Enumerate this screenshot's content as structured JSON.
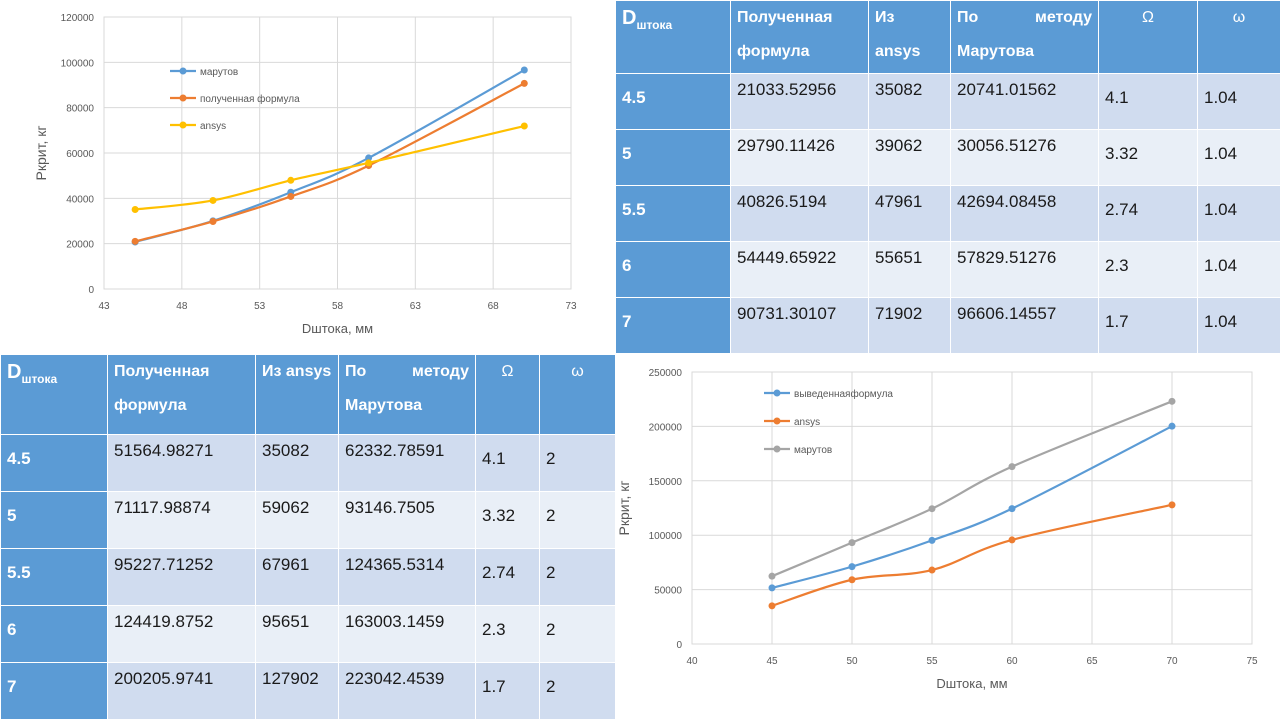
{
  "chart_data": [
    {
      "type": "line",
      "title": "",
      "xlabel": "Dштока, мм",
      "ylabel": "Pкрит, кг",
      "xlim": [
        43,
        73
      ],
      "ylim": [
        0,
        120000
      ],
      "xticks": [
        43,
        48,
        53,
        58,
        63,
        68,
        73
      ],
      "yticks": [
        0,
        20000,
        40000,
        60000,
        80000,
        100000,
        120000
      ],
      "grid": true,
      "legend_position": "top-left",
      "series": [
        {
          "name": "марутов",
          "color": "#5b9bd5",
          "x": [
            45,
            50,
            55,
            60,
            70
          ],
          "y": [
            20741,
            30057,
            42694,
            57830,
            96606
          ]
        },
        {
          "name": "полученная формула",
          "color": "#ed7d31",
          "x": [
            45,
            50,
            55,
            60,
            70
          ],
          "y": [
            21034,
            29790,
            40827,
            54450,
            90731
          ]
        },
        {
          "name": "ansys",
          "color": "#ffc000",
          "x": [
            45,
            50,
            55,
            60,
            70
          ],
          "y": [
            35082,
            39062,
            47961,
            55651,
            71902
          ]
        }
      ]
    },
    {
      "type": "line",
      "title": "",
      "xlabel": "Dштока, мм",
      "ylabel": "Pкрит, кг",
      "xlim": [
        40,
        75
      ],
      "ylim": [
        0,
        250000
      ],
      "xticks": [
        40,
        45,
        50,
        55,
        60,
        65,
        70,
        75
      ],
      "yticks": [
        0,
        50000,
        100000,
        150000,
        200000,
        250000
      ],
      "grid": true,
      "legend_position": "top-left",
      "series": [
        {
          "name": "выведеннаяформула",
          "color": "#5b9bd5",
          "x": [
            45,
            50,
            55,
            60,
            70
          ],
          "y": [
            51565,
            71118,
            95228,
            124420,
            200206
          ]
        },
        {
          "name": "ansys",
          "color": "#ed7d31",
          "x": [
            45,
            50,
            55,
            60,
            70
          ],
          "y": [
            35082,
            59062,
            67961,
            95651,
            127902
          ]
        },
        {
          "name": "марутов",
          "color": "#a5a5a5",
          "x": [
            45,
            50,
            55,
            60,
            70
          ],
          "y": [
            62333,
            93147,
            124366,
            163003,
            223042
          ]
        }
      ]
    }
  ],
  "table1": {
    "header": {
      "d_main": "D",
      "d_sub": "штока",
      "formula": "Полученная формула",
      "ansys": "Из ansys",
      "method_a": "По",
      "method_b": "методу",
      "method_c": "Марутова",
      "omega_big": "Ω",
      "omega_small": "ω"
    },
    "rows": [
      {
        "d": "4.5",
        "formula": "21033.52956",
        "ansys": "35082",
        "marutov": "20741.01562",
        "omega_big": "4.1",
        "omega_small": "1.04"
      },
      {
        "d": "5",
        "formula": "29790.11426",
        "ansys": "39062",
        "marutov": "30056.51276",
        "omega_big": "3.32",
        "omega_small": "1.04"
      },
      {
        "d": "5.5",
        "formula": "40826.5194",
        "ansys": "47961",
        "marutov": "42694.08458",
        "omega_big": "2.74",
        "omega_small": "1.04"
      },
      {
        "d": "6",
        "formula": "54449.65922",
        "ansys": "55651",
        "marutov": "57829.51276",
        "omega_big": "2.3",
        "omega_small": "1.04"
      },
      {
        "d": "7",
        "formula": "90731.30107",
        "ansys": "71902",
        "marutov": "96606.14557",
        "omega_big": "1.7",
        "omega_small": "1.04"
      }
    ]
  },
  "table2": {
    "header": {
      "d_main": "D",
      "d_sub": "штока",
      "formula": "Полученная формула",
      "ansys": "Из ansys",
      "method_a": "По",
      "method_b": "методу",
      "method_c": "Марутова",
      "omega_big": "Ω",
      "omega_small": "ω"
    },
    "rows": [
      {
        "d": "4.5",
        "formula": "51564.98271",
        "ansys": "35082",
        "marutov": "62332.78591",
        "omega_big": "4.1",
        "omega_small": "2"
      },
      {
        "d": "5",
        "formula": "71117.98874",
        "ansys": "59062",
        "marutov": "93146.7505",
        "omega_big": "3.32",
        "omega_small": "2"
      },
      {
        "d": "5.5",
        "formula": "95227.71252",
        "ansys": "67961",
        "marutov": "124365.5314",
        "omega_big": "2.74",
        "omega_small": "2"
      },
      {
        "d": "6",
        "formula": "124419.8752",
        "ansys": "95651",
        "marutov": "163003.1459",
        "omega_big": "2.3",
        "omega_small": "2"
      },
      {
        "d": "7",
        "formula": "200205.9741",
        "ansys": "127902",
        "marutov": "223042.4539",
        "omega_big": "1.7",
        "omega_small": "2"
      }
    ]
  }
}
